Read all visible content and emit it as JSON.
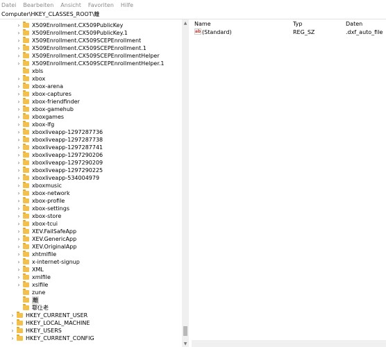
{
  "menu": [
    "Datei",
    "Bearbeiten",
    "Ansicht",
    "Favoriten",
    "Hilfe"
  ],
  "address": "Computer\\HKEY_CLASSES_ROOT\\離",
  "tree": [
    {
      "label": "X509Enrollment.CX509PublicKey",
      "expandable": true
    },
    {
      "label": "X509Enrollment.CX509PublicKey.1",
      "expandable": true
    },
    {
      "label": "X509Enrollment.CX509SCEPEnrollment",
      "expandable": true
    },
    {
      "label": "X509Enrollment.CX509SCEPEnrollment.1",
      "expandable": true
    },
    {
      "label": "X509Enrollment.CX509SCEPEnrollmentHelper",
      "expandable": true
    },
    {
      "label": "X509Enrollment.CX509SCEPEnrollmentHelper.1",
      "expandable": true
    },
    {
      "label": "xbls",
      "expandable": false
    },
    {
      "label": "xbox",
      "expandable": true
    },
    {
      "label": "xbox-arena",
      "expandable": true
    },
    {
      "label": "xbox-captures",
      "expandable": true
    },
    {
      "label": "xbox-friendfinder",
      "expandable": true
    },
    {
      "label": "xbox-gamehub",
      "expandable": true
    },
    {
      "label": "xboxgames",
      "expandable": true
    },
    {
      "label": "xbox-lfg",
      "expandable": true
    },
    {
      "label": "xboxliveapp-1297287736",
      "expandable": true
    },
    {
      "label": "xboxliveapp-1297287738",
      "expandable": true
    },
    {
      "label": "xboxliveapp-1297287741",
      "expandable": true
    },
    {
      "label": "xboxliveapp-1297290206",
      "expandable": true
    },
    {
      "label": "xboxliveapp-1297290209",
      "expandable": true
    },
    {
      "label": "xboxliveapp-1297290225",
      "expandable": true
    },
    {
      "label": "xboxliveapp-534004979",
      "expandable": true
    },
    {
      "label": "xboxmusic",
      "expandable": true
    },
    {
      "label": "xbox-network",
      "expandable": true
    },
    {
      "label": "xbox-profile",
      "expandable": true
    },
    {
      "label": "xbox-settings",
      "expandable": true
    },
    {
      "label": "xbox-store",
      "expandable": true
    },
    {
      "label": "xbox-tcui",
      "expandable": true
    },
    {
      "label": "XEV.FailSafeApp",
      "expandable": true
    },
    {
      "label": "XEV.GenericApp",
      "expandable": true
    },
    {
      "label": "XEV.OriginalApp",
      "expandable": true
    },
    {
      "label": "xhtmlfile",
      "expandable": true
    },
    {
      "label": "x-internet-signup",
      "expandable": true
    },
    {
      "label": "XML",
      "expandable": true
    },
    {
      "label": "xmlfile",
      "expandable": true
    },
    {
      "label": "xslfile",
      "expandable": true
    },
    {
      "label": "zune",
      "expandable": false
    },
    {
      "label": "離",
      "expandable": false,
      "selected": true
    },
    {
      "label": "鄠仩老",
      "expandable": false
    }
  ],
  "roots": [
    {
      "label": "HKEY_CURRENT_USER"
    },
    {
      "label": "HKEY_LOCAL_MACHINE"
    },
    {
      "label": "HKEY_USERS"
    },
    {
      "label": "HKEY_CURRENT_CONFIG"
    }
  ],
  "columns": {
    "name": "Name",
    "type": "Typ",
    "data": "Daten"
  },
  "values_rows": [
    {
      "icon": "string-value-icon",
      "icon_text": "ab",
      "name": "(Standard)",
      "type": "REG_SZ",
      "data": ".dxf_auto_file"
    }
  ]
}
